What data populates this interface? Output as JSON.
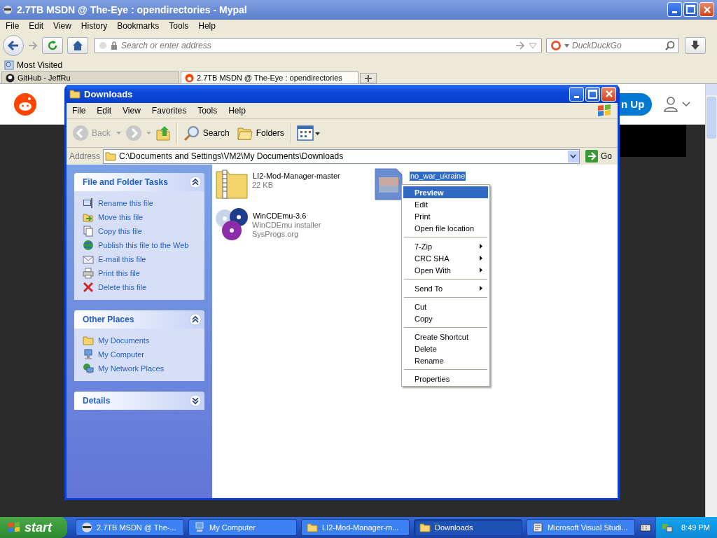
{
  "browser": {
    "title": "2.7TB MSDN @ The-Eye : opendirectories - Mypal",
    "menu": [
      "File",
      "Edit",
      "View",
      "History",
      "Bookmarks",
      "Tools",
      "Help"
    ],
    "address": {
      "placeholder": "Search or enter address"
    },
    "search": {
      "placeholder": "DuckDuckGo"
    },
    "bookmarks": [
      "Most Visited"
    ],
    "tabs": [
      {
        "label": "GitHub - JeffRu",
        "selected": false
      },
      {
        "label": "2.7TB MSDN @ The-Eye : opendirectories",
        "selected": true
      }
    ],
    "page": {
      "signup_button": "n Up"
    }
  },
  "explorer": {
    "title": "Downloads",
    "menu": [
      "File",
      "Edit",
      "View",
      "Favorites",
      "Tools",
      "Help"
    ],
    "toolbar": {
      "back": {
        "label": "Back",
        "disabled": true
      },
      "search": "Search",
      "folders": "Folders"
    },
    "address_label": "Address",
    "address": "C:\\Documents and Settings\\VM2\\My Documents\\Downloads",
    "go": "Go",
    "panels": [
      {
        "title": "File and Folder Tasks",
        "expanded": true,
        "items": [
          {
            "label": "Rename this file",
            "kind": "rename"
          },
          {
            "label": "Move this file",
            "kind": "move"
          },
          {
            "label": "Copy this file",
            "kind": "copy"
          },
          {
            "label": "Publish this file to the Web",
            "kind": "publish"
          },
          {
            "label": "E-mail this file",
            "kind": "email"
          },
          {
            "label": "Print this file",
            "kind": "print"
          },
          {
            "label": "Delete this file",
            "kind": "delete"
          }
        ]
      },
      {
        "title": "Other Places",
        "expanded": true,
        "items": [
          {
            "label": "My Documents",
            "kind": "documents"
          },
          {
            "label": "My Computer",
            "kind": "computer"
          },
          {
            "label": "My Network Places",
            "kind": "network"
          }
        ]
      },
      {
        "title": "Details",
        "expanded": false
      }
    ],
    "files": [
      {
        "name": "LI2-Mod-Manager-master",
        "lines": [
          "22 KB"
        ],
        "kind": "zip",
        "selected": false
      },
      {
        "name": "WinCDEmu-3.6",
        "lines": [
          "WinCDEmu installer",
          "SysProgs.org"
        ],
        "kind": "installer",
        "selected": false
      },
      {
        "name": "no_war_ukraine",
        "kind": "image",
        "selected": true
      }
    ]
  },
  "context_menu": {
    "groups": [
      [
        {
          "label": "Preview",
          "default": true,
          "selected": true,
          "submenu": false
        },
        {
          "label": "Edit",
          "default": false,
          "selected": false,
          "submenu": false
        },
        {
          "label": "Print",
          "default": false,
          "selected": false,
          "submenu": false
        },
        {
          "label": "Open file location",
          "default": false,
          "selected": false,
          "submenu": false
        }
      ],
      [
        {
          "label": "7-Zip",
          "default": false,
          "selected": false,
          "submenu": true
        },
        {
          "label": "CRC SHA",
          "default": false,
          "selected": false,
          "submenu": true
        },
        {
          "label": "Open With",
          "default": false,
          "selected": false,
          "submenu": true
        }
      ],
      [
        {
          "label": "Send To",
          "default": false,
          "selected": false,
          "submenu": true
        }
      ],
      [
        {
          "label": "Cut",
          "default": false,
          "selected": false,
          "submenu": false
        },
        {
          "label": "Copy",
          "default": false,
          "selected": false,
          "submenu": false
        }
      ],
      [
        {
          "label": "Create Shortcut",
          "default": false,
          "selected": false,
          "submenu": false
        },
        {
          "label": "Delete",
          "default": false,
          "selected": false,
          "submenu": false
        },
        {
          "label": "Rename",
          "default": false,
          "selected": false,
          "submenu": false
        }
      ],
      [
        {
          "label": "Properties",
          "default": false,
          "selected": false,
          "submenu": false
        }
      ]
    ]
  },
  "taskbar": {
    "start": "start",
    "tasks": [
      {
        "label": "2.7TB MSDN @ The-...",
        "kind": "browser",
        "selected": false
      },
      {
        "label": "My Computer",
        "kind": "computer",
        "selected": false
      },
      {
        "label": "LI2-Mod-Manager-m...",
        "kind": "folder",
        "selected": false
      },
      {
        "label": "Downloads",
        "kind": "folder",
        "selected": true
      },
      {
        "label": "Microsoft Visual Studi...",
        "kind": "app",
        "selected": false
      }
    ],
    "clock": "8:49 PM"
  }
}
